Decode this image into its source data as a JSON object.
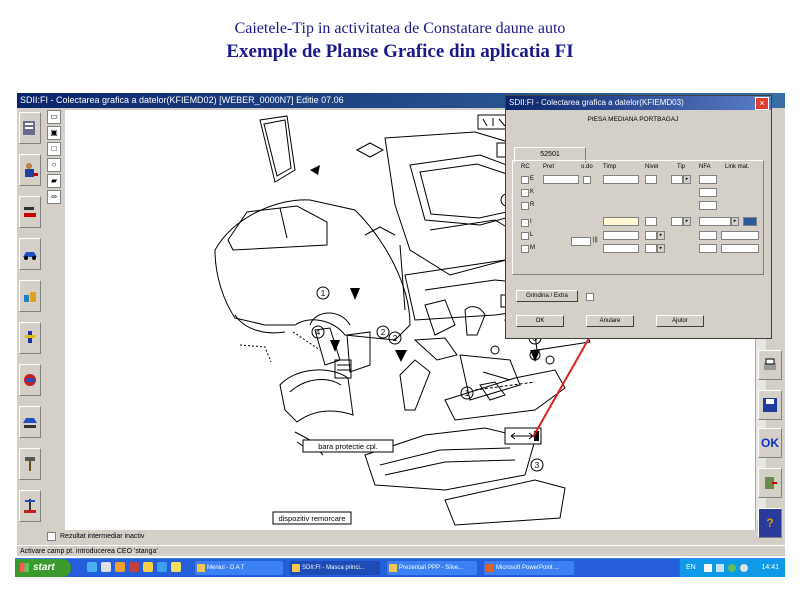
{
  "slide": {
    "title_line1": "Caietele-Tip in activitatea de Constatare daune auto",
    "title_line2": "Exemple de Planse Grafice din aplicatia FI"
  },
  "app": {
    "window_title": "SDII:FI - Colectarea grafica a datelor(KFIEMD02) [WEBER_0000N7]   Editie 07.06",
    "left_tools": [
      "reports-icon",
      "document-edit-icon",
      "mechanic-icon",
      "wrench-car-icon",
      "car-bodywork-icon",
      "parts-icon",
      "paint-gun-icon",
      "car-wash-icon",
      "car-lift-icon",
      "hammer-icon",
      "jack-icon"
    ],
    "small_tools": [
      "select-icon",
      "zoom-icon",
      "rect-icon",
      "circle-icon",
      "car-mini-icon",
      "binoculars-icon"
    ],
    "right_tools": [
      "printer-icon",
      "save-disk-icon",
      "ok-icon",
      "exit-door-icon",
      "help-icon"
    ],
    "checkbox_label": "Rezultat intermediar inactiv",
    "status_text": "Activare camp pt. introducerea CEO 'stanga'",
    "diagram_labels": [
      "bara protectie cpl.",
      "dispozitiv remorcare",
      "DA"
    ],
    "callout_numbers": [
      "1",
      "1",
      "1",
      "2",
      "2",
      "3",
      "3",
      "4"
    ]
  },
  "dialog": {
    "title": "SDII:FI - Colectarea grafica a datelor(KFIEMD03)",
    "close": "×",
    "part_name": "PIESA MEDIANA PORTBAGAJ",
    "tab_label": "52501",
    "headers": [
      "RC",
      "Pret",
      "o.do",
      "Timp",
      "Nivel",
      "Tip",
      "NFA",
      "Link mat."
    ],
    "row_codes": [
      "E",
      "K",
      "R",
      "I",
      "L",
      "M"
    ],
    "row_icon_text": "|||",
    "button_grindina": "Grindina / Extra",
    "button_ok": "OK",
    "button_anulare": "Anulare",
    "button_ajutor": "Ajutor"
  },
  "taskbar": {
    "start": "start",
    "tasks": [
      "Meniul - D A T",
      "SDII:FI - Masca princi...",
      "Prezentari PPP - Silve...",
      "Microsoft PowerPoint ..."
    ],
    "tray_lang": "EN",
    "clock": "14:41"
  },
  "colors": {
    "title_text": "#1a1a8c",
    "titlebar": "#0a246a",
    "taskbar": "#245edb",
    "start": "#3a9a2c",
    "arrow": "#e02020"
  }
}
